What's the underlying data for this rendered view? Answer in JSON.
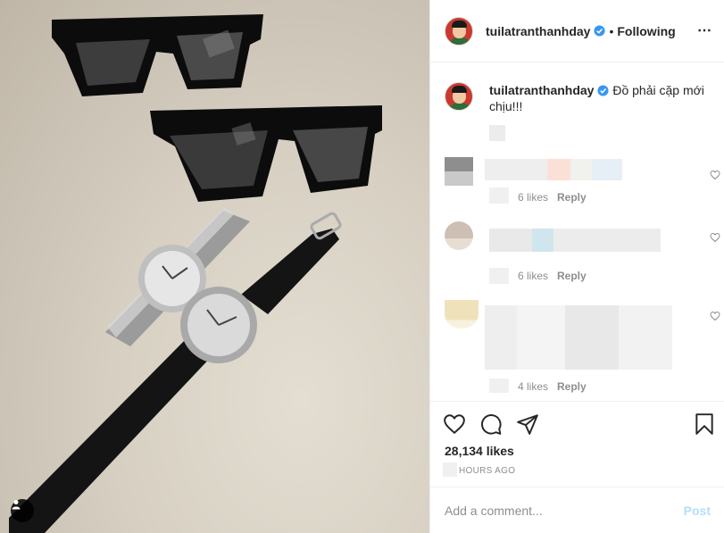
{
  "header": {
    "username": "tuilatranthanhday",
    "separator": "•",
    "follow_status": "Following",
    "more_icon": "more-horizontal-icon"
  },
  "caption": {
    "username": "tuilatranthanhday",
    "text": "Đồ phải cặp mới chịu!!!"
  },
  "comments": [
    {
      "likes_text": "6 likes",
      "reply_label": "Reply"
    },
    {
      "likes_text": "6 likes",
      "reply_label": "Reply"
    },
    {
      "likes_text": "4 likes",
      "reply_label": "Reply"
    }
  ],
  "actions": {
    "like_icon": "heart-icon",
    "comment_icon": "comment-icon",
    "share_icon": "share-icon",
    "save_icon": "bookmark-icon",
    "likes_text": "28,134 likes",
    "timestamp": "HOURS AGO"
  },
  "comment_box": {
    "placeholder": "Add a comment...",
    "post_label": "Post"
  },
  "colors": {
    "verified": "#3897f0",
    "text": "#262626",
    "muted": "#8e8e8e",
    "post_disabled": "#b2dffc",
    "border": "#efefef"
  }
}
